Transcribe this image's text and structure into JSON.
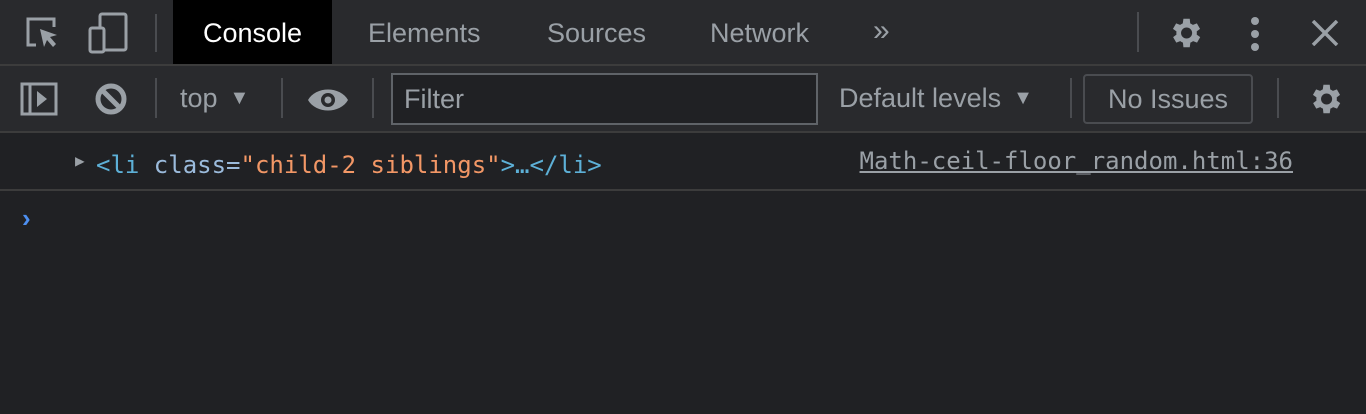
{
  "tabs": [
    {
      "label": "Console",
      "active": true
    },
    {
      "label": "Elements"
    },
    {
      "label": "Sources"
    },
    {
      "label": "Network"
    }
  ],
  "toolbar": {
    "context": "top",
    "filter_placeholder": "Filter",
    "levels": "Default levels",
    "issues": "No Issues"
  },
  "log": {
    "open": "<li",
    "attr_name": " class=",
    "attr_value": "\"child-2 siblings\"",
    "close": ">…</li>",
    "source": "Math-ceil-floor_random.html:36"
  },
  "colors": {
    "tag": "#5db0d7",
    "value": "#f29766",
    "prompt": "#4d8ff0"
  }
}
